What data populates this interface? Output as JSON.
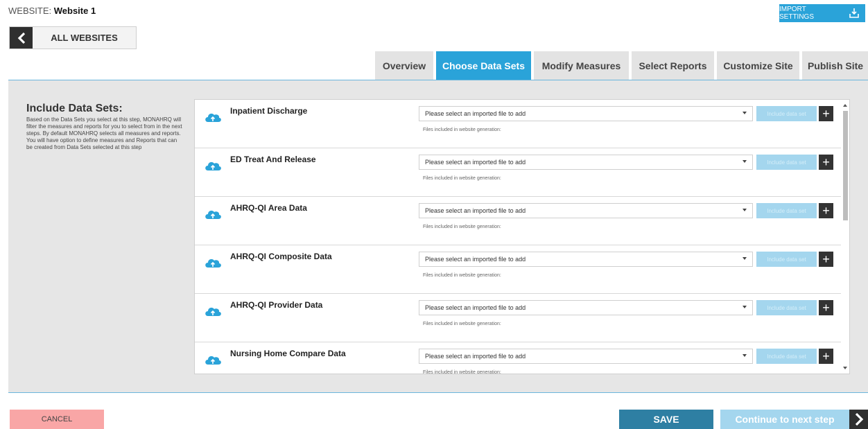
{
  "header": {
    "website_prefix": "WEBSITE:",
    "website_name": "Website 1",
    "import_settings_label": "IMPORT SETTINGS",
    "all_websites_label": "ALL WEBSITES"
  },
  "tabs": [
    {
      "label": "Overview",
      "active": false
    },
    {
      "label": "Choose Data Sets",
      "active": true
    },
    {
      "label": "Modify Measures",
      "active": false
    },
    {
      "label": "Select Reports",
      "active": false
    },
    {
      "label": "Customize Site",
      "active": false
    },
    {
      "label": "Publish Site",
      "active": false
    }
  ],
  "sidebar": {
    "title": "Include Data Sets:",
    "description": "Based on the Data Sets you select at this step, MONAHRQ will filter the measures and reports for you to select from in the next steps. By default MONAHRQ selects all measures and reports. You will have option to define measures and Reports that can be created from Data Sets selected at this step"
  },
  "datasets": {
    "select_placeholder": "Please select an imported file to add",
    "include_label": "Include data set",
    "plus_label": "+",
    "files_note": "Files included in website generation:",
    "items": [
      {
        "name": "Inpatient Discharge"
      },
      {
        "name": "ED Treat And Release"
      },
      {
        "name": "AHRQ-QI Area Data"
      },
      {
        "name": "AHRQ-QI Composite Data"
      },
      {
        "name": "AHRQ-QI Provider Data"
      },
      {
        "name": "Nursing Home Compare Data"
      }
    ]
  },
  "footer": {
    "cancel_label": "CANCEL",
    "save_label": "SAVE",
    "continue_label": "Continue to next step"
  },
  "colors": {
    "accent": "#2aa3d9",
    "save": "#2e7fa3",
    "cancel": "#f9a6a6",
    "disabled": "#a4d6ee"
  }
}
